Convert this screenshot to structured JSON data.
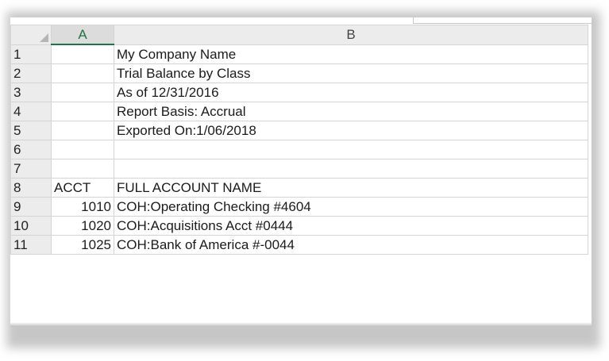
{
  "columns": [
    "A",
    "B"
  ],
  "rows": [
    {
      "num": "1",
      "a": "",
      "b": "My Company Name"
    },
    {
      "num": "2",
      "a": "",
      "b": "Trial Balance by Class"
    },
    {
      "num": "3",
      "a": "",
      "b": "As of 12/31/2016"
    },
    {
      "num": "4",
      "a": "",
      "b": "Report Basis: Accrual"
    },
    {
      "num": "5",
      "a": "",
      "b": "Exported On:1/06/2018"
    },
    {
      "num": "6",
      "a": "",
      "b": ""
    },
    {
      "num": "7",
      "a": "",
      "b": ""
    },
    {
      "num": "8",
      "a": "ACCT",
      "b": "FULL ACCOUNT NAME"
    },
    {
      "num": "9",
      "a": "1010",
      "b": "COH:Operating Checking #4604"
    },
    {
      "num": "10",
      "a": "1020",
      "b": "COH:Acquisitions Acct #0444"
    },
    {
      "num": "11",
      "a": "1025",
      "b": "COH:Bank of America #-0044"
    }
  ],
  "colors": {
    "accent": "#217346",
    "header_bg": "#ececec",
    "gridline": "#d4d4d4"
  }
}
